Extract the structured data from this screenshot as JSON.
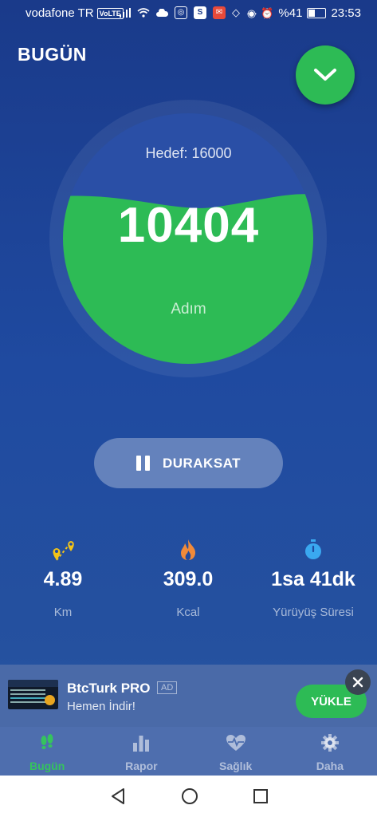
{
  "status_bar": {
    "carrier": "vodafone TR",
    "volte": "VoLTE",
    "battery": "%41",
    "time": "23:53",
    "battery_level": 0.41
  },
  "header": {
    "title": "BUGÜN"
  },
  "progress": {
    "goal_text": "Hedef: 16000",
    "steps": "10404",
    "steps_label": "Adım",
    "fill_fraction": 0.65
  },
  "pause_button": {
    "label": "DURAKSAT"
  },
  "stats": [
    {
      "icon": "location-pins-icon",
      "value": "4.89",
      "label": "Km",
      "color": "#f2c318"
    },
    {
      "icon": "flame-icon",
      "value": "309.0",
      "label": "Kcal",
      "color": "#f08a3a"
    },
    {
      "icon": "stopwatch-icon",
      "value": "1sa 41dk",
      "label": "Yürüyüş Süresi",
      "color": "#3aa8f0"
    }
  ],
  "ad": {
    "title": "BtcTurk PRO",
    "tag": "AD",
    "subtitle": "Hemen İndir!",
    "button": "YÜKLE"
  },
  "tabs": [
    {
      "icon": "footsteps-icon",
      "label": "Bugün",
      "active": true
    },
    {
      "icon": "bar-chart-icon",
      "label": "Rapor",
      "active": false
    },
    {
      "icon": "heart-pulse-icon",
      "label": "Sağlık",
      "active": false
    },
    {
      "icon": "gear-icon",
      "label": "Daha",
      "active": false
    }
  ],
  "colors": {
    "accent": "#2dbb55",
    "background": "#1f4aa0"
  }
}
